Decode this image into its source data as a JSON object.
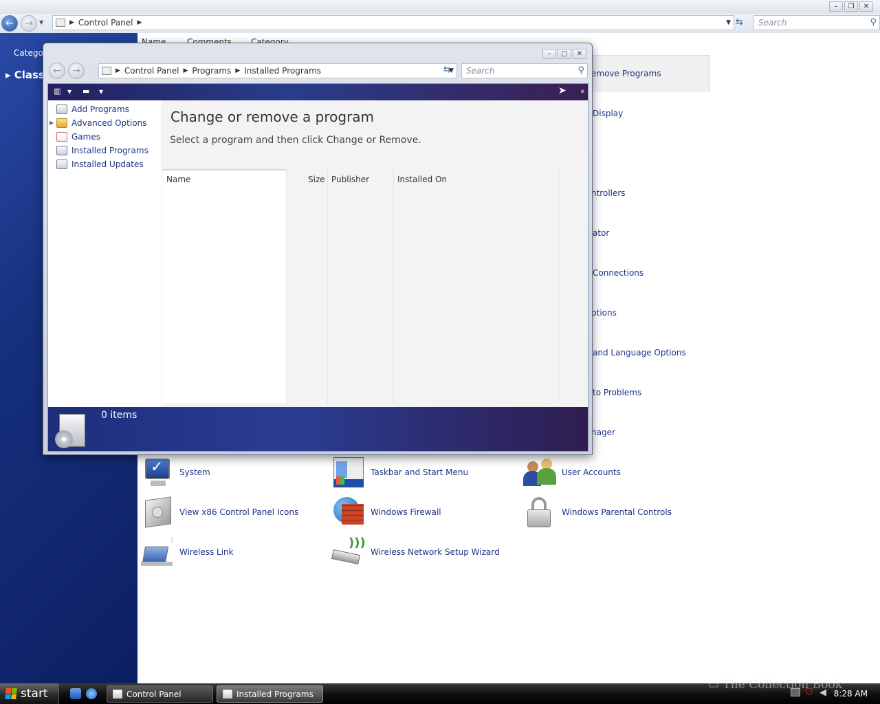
{
  "background_window": {
    "address": {
      "crumbs": [
        "Control Panel"
      ]
    },
    "search_placeholder": "Search",
    "sidebar": {
      "category_view": "Category",
      "classic_view": "Classic"
    },
    "column_headers": [
      "Name",
      "Comments",
      "Category"
    ],
    "right_items": [
      "emove Programs",
      "Display",
      "ntrollers",
      "ator",
      "Connections",
      "ptions",
      "and Language Options",
      "to Problems",
      "nager"
    ],
    "items": [
      {
        "label": "System",
        "icon": "system-icon"
      },
      {
        "label": "Taskbar and Start Menu",
        "icon": "taskbar-icon"
      },
      {
        "label": "User Accounts",
        "icon": "user-accounts-icon"
      },
      {
        "label": "View x86 Control Panel Icons",
        "icon": "control-panel-icon"
      },
      {
        "label": "Windows Firewall",
        "icon": "firewall-icon"
      },
      {
        "label": "Windows Parental Controls",
        "icon": "parental-controls-icon"
      },
      {
        "label": "Wireless Link",
        "icon": "wireless-link-icon"
      },
      {
        "label": "Wireless Network Setup Wizard",
        "icon": "wireless-network-icon"
      }
    ]
  },
  "window": {
    "address": {
      "crumbs": [
        "Control Panel",
        "Programs",
        "Installed Programs"
      ]
    },
    "search_placeholder": "Search",
    "nav": [
      {
        "label": "Add Programs"
      },
      {
        "label": "Advanced Options"
      },
      {
        "label": "Games"
      },
      {
        "label": "Installed Programs"
      },
      {
        "label": "Installed Updates"
      }
    ],
    "heading": "Change or remove a program",
    "subheading": "Select a program and then click Change or Remove.",
    "columns": [
      "Name",
      "Size",
      "Publisher",
      "Installed On"
    ],
    "status": "0 items"
  },
  "taskbar": {
    "start_label": "start",
    "tasks": [
      "Control Panel",
      "Installed Programs"
    ],
    "clock": "8:28 AM",
    "watermark": "The Collection Book"
  }
}
